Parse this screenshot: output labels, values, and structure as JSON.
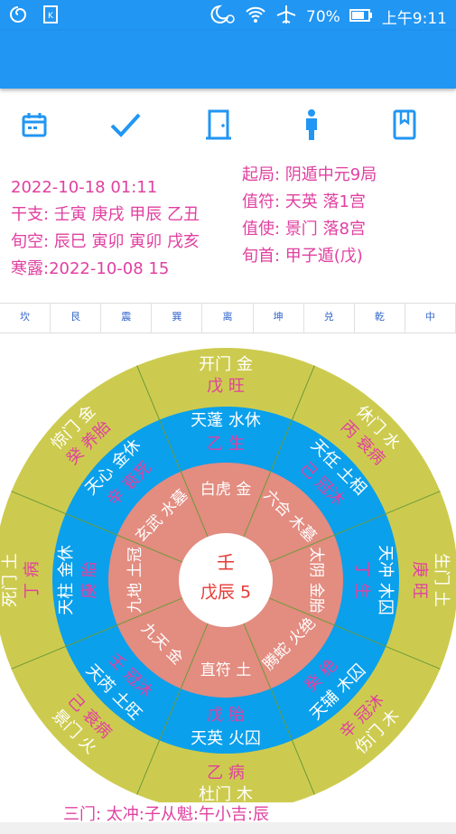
{
  "status": {
    "battery": "70%",
    "time": "上午9:11"
  },
  "info_left": [
    "2022-10-18 01:11",
    "干支: 壬寅 庚戌 甲辰 乙丑",
    "旬空: 辰巳 寅卯 寅卯 戌亥",
    "寒露:2022-10-08 15"
  ],
  "info_right": [
    "起局: 阴遁中元9局",
    "值符: 天英 落1宫",
    "值使: 景门 落8宫",
    "旬首: 甲子遁(戊)"
  ],
  "tabs": [
    "坎",
    "艮",
    "震",
    "巽",
    "离",
    "坤",
    "兑",
    "乾",
    "中"
  ],
  "center": {
    "top": "壬",
    "bottom": "戊辰 5"
  },
  "palaces": [
    {
      "outer1": "开门 金",
      "outer2": "戊 旺",
      "mid1": "天蓬 水休",
      "mid2": "乙 生",
      "inner": "白虎 金"
    },
    {
      "outer1": "休门 水",
      "outer2": "丙 衰病",
      "mid1": "天任 土相",
      "mid2": "己 冠沐",
      "inner": "六合 木墓"
    },
    {
      "outer1": "生门 土",
      "outer2": "庚 旺",
      "mid1": "天冲 木囚",
      "mid2": "丁 生",
      "inner": "太阴 金胎"
    },
    {
      "outer1": "伤门 木",
      "outer2": "辛 冠沐",
      "mid1": "天辅 木囚",
      "mid2": "癸 绝",
      "inner": "腾蛇 火绝"
    },
    {
      "outer1": "杜门 木",
      "outer2": "乙 病",
      "mid1": "天英 火囚",
      "mid2": "戊 胎",
      "inner": "直符 土"
    },
    {
      "outer1": "景门 火",
      "outer2": "己 衰病",
      "mid1": "天芮 土旺",
      "mid2": "壬 冠沐",
      "inner": "九天 金"
    },
    {
      "outer1": "死门 土",
      "outer2": "丁 病",
      "mid1": "天柱 金休",
      "mid2": "庚 胎",
      "inner": "九地 土冠"
    },
    {
      "outer1": "惊门 金",
      "outer2": "癸 养胎",
      "mid1": "天心 金休",
      "mid2": "辛 衰死",
      "inner": "玄武 水墓"
    }
  ],
  "bottom_text": "三门: 太冲:子从魁:午小吉:辰",
  "colors": {
    "outer": "#CDCB4F",
    "mid": "#0AA0EC",
    "inner": "#E38C80",
    "pink": "#E040A0"
  }
}
